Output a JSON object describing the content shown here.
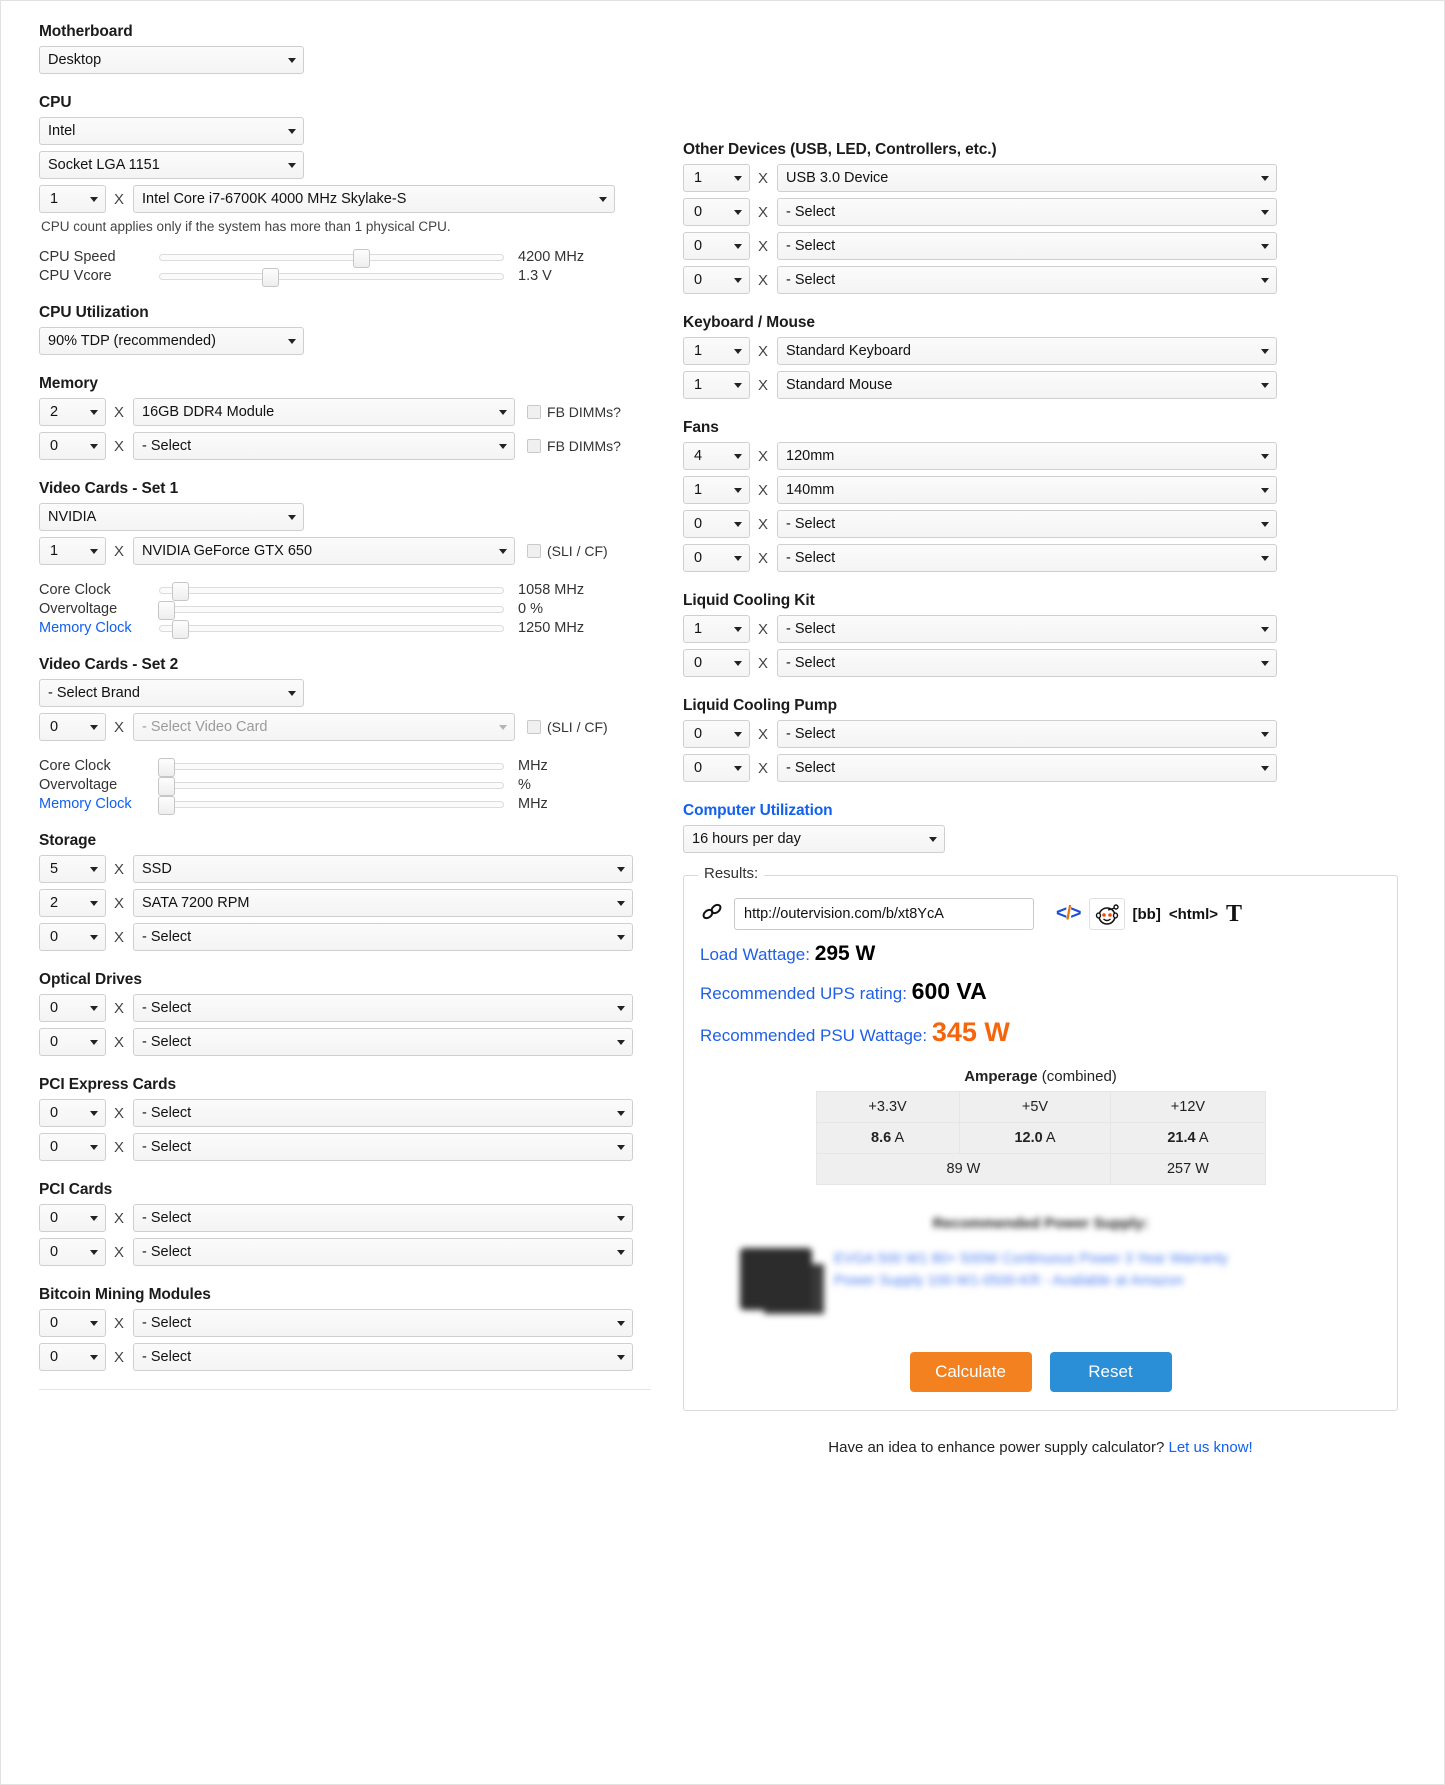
{
  "left": {
    "motherboard": {
      "heading": "Motherboard",
      "value": "Desktop"
    },
    "cpu": {
      "heading": "CPU",
      "brand": "Intel",
      "socket": "Socket LGA 1151",
      "count": "1",
      "x": "X",
      "model": "Intel Core i7-6700K 4000 MHz Skylake-S",
      "note": "CPU count applies only if the system has more than 1 physical CPU.",
      "speed_label": "CPU Speed",
      "speed_value": "4200 MHz",
      "vcore_label": "CPU Vcore",
      "vcore_value": "1.3 V"
    },
    "cpu_util": {
      "heading": "CPU Utilization",
      "value": "90% TDP (recommended)"
    },
    "memory": {
      "heading": "Memory",
      "rows": [
        {
          "count": "2",
          "x": "X",
          "value": "16GB DDR4 Module",
          "checkbox": "FB DIMMs?"
        },
        {
          "count": "0",
          "x": "X",
          "value": "- Select",
          "checkbox": "FB DIMMs?"
        }
      ]
    },
    "video1": {
      "heading": "Video Cards - Set 1",
      "brand": "NVIDIA",
      "count": "1",
      "x": "X",
      "model": "NVIDIA GeForce GTX 650",
      "sli": "(SLI / CF)",
      "core_label": "Core Clock",
      "core_value": "1058 MHz",
      "over_label": "Overvoltage",
      "over_value": "0 %",
      "mem_label": "Memory Clock",
      "mem_value": "1250 MHz"
    },
    "video2": {
      "heading": "Video Cards - Set 2",
      "brand": "- Select Brand",
      "count": "0",
      "x": "X",
      "model": "- Select Video Card",
      "sli": "(SLI / CF)",
      "core_label": "Core Clock",
      "core_value": "MHz",
      "over_label": "Overvoltage",
      "over_value": "%",
      "mem_label": "Memory Clock",
      "mem_value": "MHz"
    },
    "storage": {
      "heading": "Storage",
      "rows": [
        {
          "count": "5",
          "x": "X",
          "value": "SSD"
        },
        {
          "count": "2",
          "x": "X",
          "value": "SATA 7200 RPM"
        },
        {
          "count": "0",
          "x": "X",
          "value": "- Select"
        }
      ]
    },
    "optical": {
      "heading": "Optical Drives",
      "rows": [
        {
          "count": "0",
          "x": "X",
          "value": "- Select"
        },
        {
          "count": "0",
          "x": "X",
          "value": "- Select"
        }
      ]
    },
    "pcie": {
      "heading": "PCI Express Cards",
      "rows": [
        {
          "count": "0",
          "x": "X",
          "value": "- Select"
        },
        {
          "count": "0",
          "x": "X",
          "value": "- Select"
        }
      ]
    },
    "pci": {
      "heading": "PCI Cards",
      "rows": [
        {
          "count": "0",
          "x": "X",
          "value": "- Select"
        },
        {
          "count": "0",
          "x": "X",
          "value": "- Select"
        }
      ]
    },
    "bitcoin": {
      "heading": "Bitcoin Mining Modules",
      "rows": [
        {
          "count": "0",
          "x": "X",
          "value": "- Select"
        },
        {
          "count": "0",
          "x": "X",
          "value": "- Select"
        }
      ]
    }
  },
  "right": {
    "other_devices": {
      "heading": "Other Devices (USB, LED, Controllers, etc.)",
      "rows": [
        {
          "count": "1",
          "x": "X",
          "value": "USB 3.0 Device"
        },
        {
          "count": "0",
          "x": "X",
          "value": "- Select"
        },
        {
          "count": "0",
          "x": "X",
          "value": "- Select"
        },
        {
          "count": "0",
          "x": "X",
          "value": "- Select"
        }
      ]
    },
    "keyboard_mouse": {
      "heading": "Keyboard / Mouse",
      "rows": [
        {
          "count": "1",
          "x": "X",
          "value": "Standard Keyboard"
        },
        {
          "count": "1",
          "x": "X",
          "value": "Standard Mouse"
        }
      ]
    },
    "fans": {
      "heading": "Fans",
      "rows": [
        {
          "count": "4",
          "x": "X",
          "value": "120mm"
        },
        {
          "count": "1",
          "x": "X",
          "value": "140mm"
        },
        {
          "count": "0",
          "x": "X",
          "value": "- Select"
        },
        {
          "count": "0",
          "x": "X",
          "value": "- Select"
        }
      ]
    },
    "liquid_kit": {
      "heading": "Liquid Cooling Kit",
      "rows": [
        {
          "count": "1",
          "x": "X",
          "value": "- Select"
        },
        {
          "count": "0",
          "x": "X",
          "value": "- Select"
        }
      ]
    },
    "liquid_pump": {
      "heading": "Liquid Cooling Pump",
      "rows": [
        {
          "count": "0",
          "x": "X",
          "value": "- Select"
        },
        {
          "count": "0",
          "x": "X",
          "value": "- Select"
        }
      ]
    },
    "computer_util": {
      "heading": "Computer Utilization",
      "value": "16 hours per day"
    },
    "results": {
      "legend": "Results:",
      "url": "http://outervision.com/b/xt8YcA",
      "share": {
        "code": "</>",
        "bb": "[bb]",
        "html": "<html>",
        "text": "T"
      },
      "load_label": "Load Wattage:",
      "load_value": "295 W",
      "ups_label": "Recommended UPS rating:",
      "ups_value": "600 VA",
      "psu_label": "Recommended PSU Wattage:",
      "psu_value": "345 W",
      "amp_title_bold": "Amperage",
      "amp_title_rest": " (combined)",
      "amp_headers": [
        "+3.3V",
        "+5V",
        "+12V"
      ],
      "amp_values": [
        "8.6",
        "12.0",
        "21.4"
      ],
      "amp_unit": "A",
      "amp_watts": [
        "89 W",
        "257 W"
      ],
      "psu_rec_title": "Recommended Power Supply:",
      "psu_rec_link": "EVGA 500 W1 80+ 500W Continuous Power 3 Year Warranty Power Supply 100-W1-0500-KR - Available at Amazon",
      "calculate": "Calculate",
      "reset": "Reset"
    },
    "footer": {
      "text": "Have an idea to enhance power supply calculator? ",
      "link": "Let us know!"
    }
  }
}
